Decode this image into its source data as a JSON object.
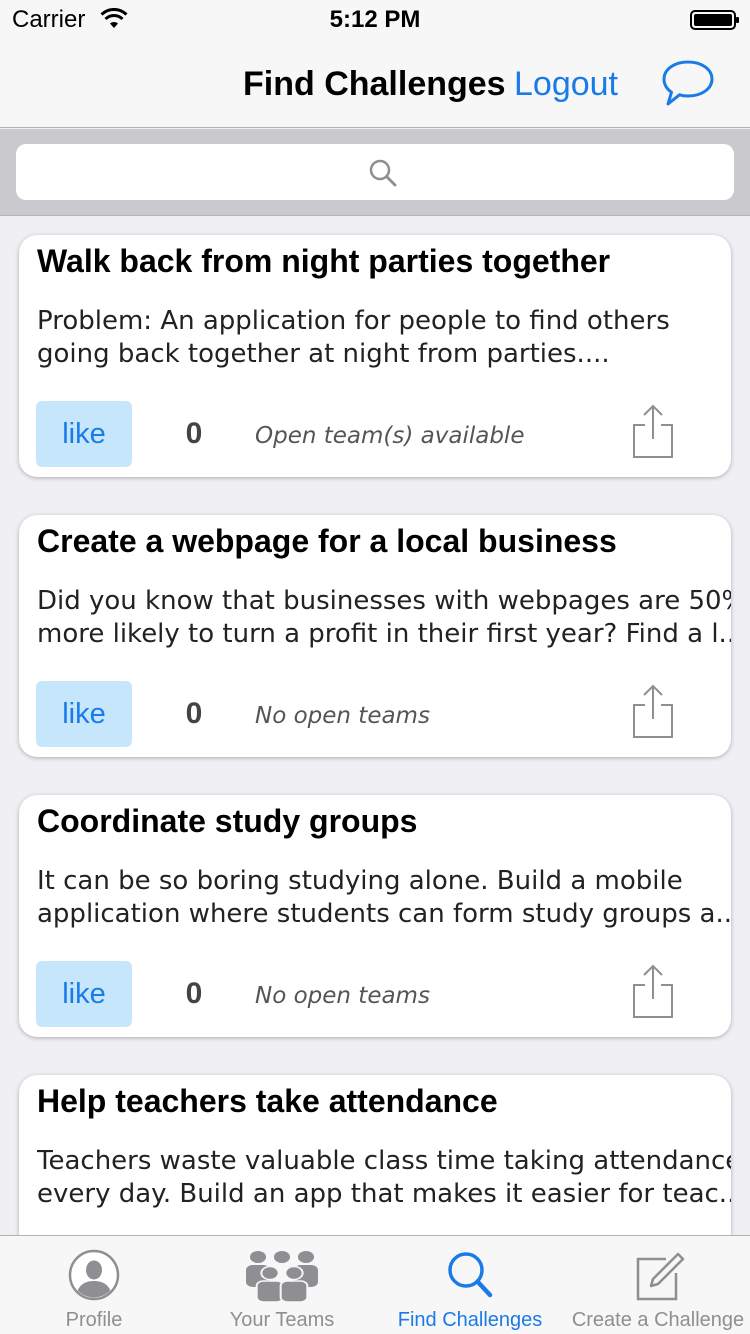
{
  "status_bar": {
    "carrier": "Carrier",
    "time": "5:12 PM"
  },
  "nav": {
    "title": "Find Challenges",
    "logout_label": "Logout",
    "chat_icon": "chat-bubble-icon"
  },
  "search": {
    "placeholder": "",
    "icon": "search-icon"
  },
  "challenges": [
    {
      "title": "Walk back from night parties together",
      "desc_lines": [
        "Problem: An application for people to find others",
        "going back together at night from parties...."
      ],
      "like_label": "like",
      "likes": "0",
      "team_status": "Open team(s) available"
    },
    {
      "title": "Create a webpage for a local business",
      "desc_lines": [
        "Did you know that businesses with webpages are 50%",
        "more likely to turn a profit in their first year? Find a l..."
      ],
      "like_label": "like",
      "likes": "0",
      "team_status": "No open teams"
    },
    {
      "title": "Coordinate study groups",
      "desc_lines": [
        "It can be so boring studying alone. Build a mobile",
        "application where students can form study groups a..."
      ],
      "like_label": "like",
      "likes": "0",
      "team_status": "No open teams"
    },
    {
      "title": "Help teachers take attendance",
      "desc_lines": [
        "Teachers waste valuable class time taking attendance",
        "every day. Build an app that makes it easier for teac..."
      ],
      "like_label": "",
      "likes": "",
      "team_status": ""
    }
  ],
  "tabs": [
    {
      "label": "Profile",
      "icon": "profile-icon",
      "active": false
    },
    {
      "label": "Your Teams",
      "icon": "teams-icon",
      "active": false
    },
    {
      "label": "Find Challenges",
      "icon": "search-icon",
      "active": true
    },
    {
      "label": "Create a Challenge",
      "icon": "compose-icon",
      "active": false
    }
  ],
  "colors": {
    "accent": "#1a7be8",
    "like_bg": "#c6e6fb",
    "inactive_tab": "#8e8e93"
  }
}
